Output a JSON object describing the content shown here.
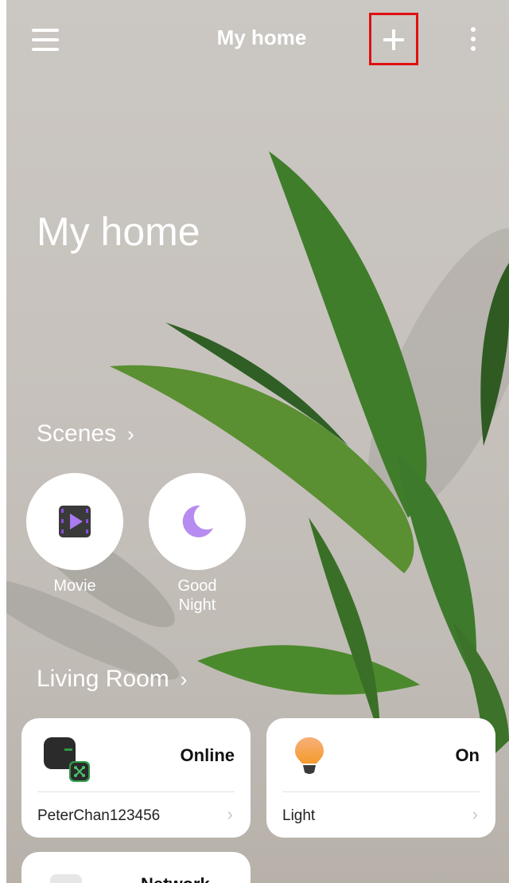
{
  "header": {
    "title": "My home"
  },
  "home": {
    "title": "My home"
  },
  "scenes": {
    "title": "Scenes",
    "items": [
      {
        "label": "Movie",
        "icon": "movie-icon"
      },
      {
        "label": "Good\nNight",
        "icon": "moon-icon"
      }
    ]
  },
  "room": {
    "title": "Living Room",
    "devices": [
      {
        "name": "PeterChan123456",
        "status": "Online",
        "icon": "gateway-icon"
      },
      {
        "name": "Light",
        "status": "On",
        "icon": "bulb-icon"
      }
    ],
    "partial_card_text": "Network"
  },
  "colors": {
    "highlight": "#e01010",
    "moon": "#b78cf0",
    "movie": "#8a4de0"
  }
}
